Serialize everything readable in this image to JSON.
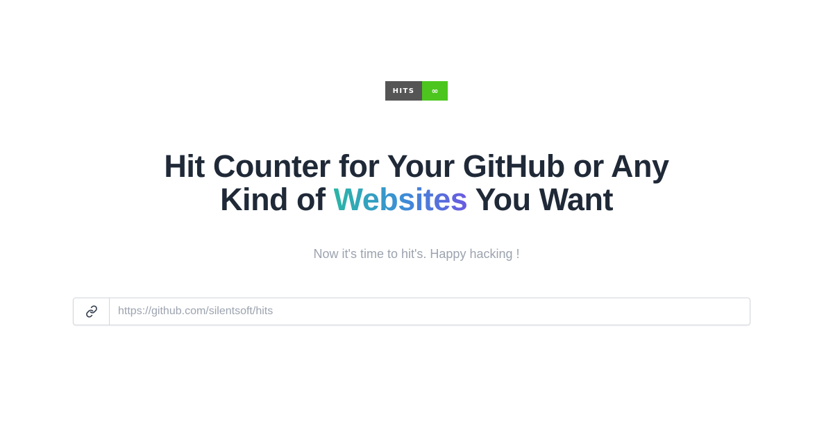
{
  "badge": {
    "label": "HITS",
    "value": "∞",
    "label_color": "#555555",
    "value_color": "#4cc61e"
  },
  "headline": {
    "line1": "Hit Counter for Your GitHub or Any",
    "line2_prefix": "Kind of ",
    "line2_highlight": "Websites",
    "line2_suffix": " You Want",
    "color": "#1f2937"
  },
  "subtitle": "Now it's time to hit's. Happy hacking !",
  "url_input": {
    "value": "",
    "placeholder": "https://github.com/silentsoft/hits",
    "icon": "link-icon"
  }
}
